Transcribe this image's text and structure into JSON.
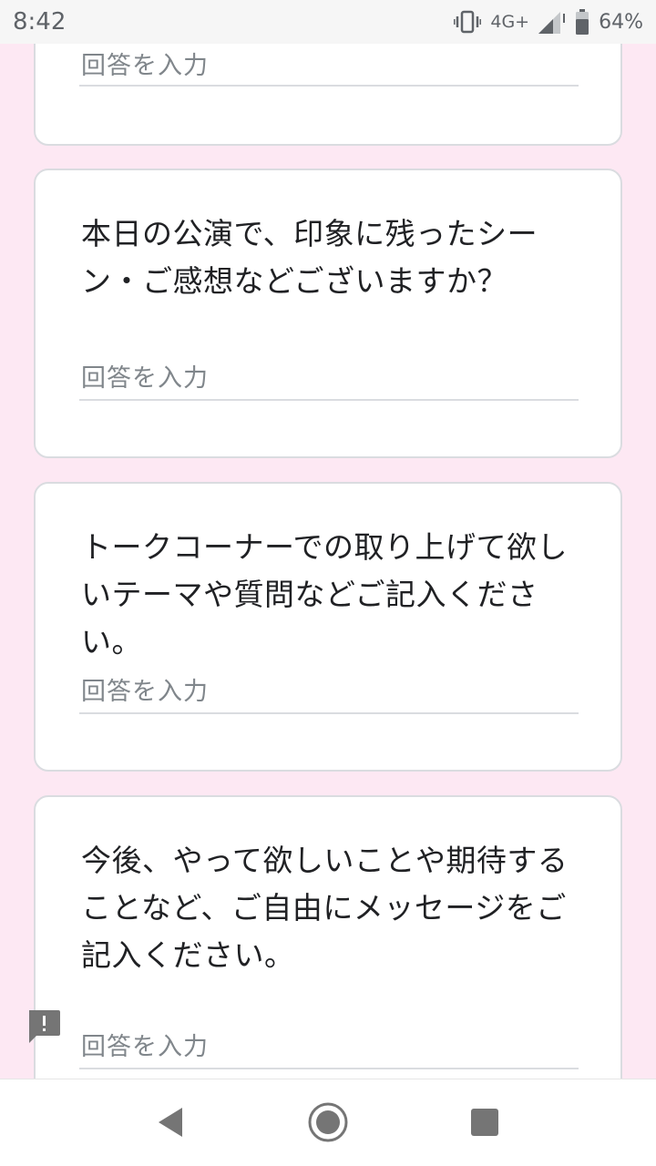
{
  "status_bar": {
    "time": "8:42",
    "network": "4G+",
    "battery": "64%"
  },
  "answer_placeholder": "回答を入力",
  "questions": [
    {
      "text": ""
    },
    {
      "text": "本日の公演で、印象に残ったシーン・ご感想などございますか？"
    },
    {
      "text": "トークコーナーでの取り上げて欲しいテーマや質問などご記入ください。"
    },
    {
      "text": "今後、やって欲しいことや期待することなど、ご自由にメッセージをご記入ください。"
    }
  ],
  "icons": {
    "vibrate": "vibrate-icon",
    "signal": "signal-icon",
    "battery": "battery-icon",
    "feedback": "feedback-icon",
    "back": "back-icon",
    "home": "home-icon",
    "recents": "recents-icon"
  },
  "colors": {
    "page_background": "#fde8f3",
    "card_background": "#ffffff",
    "card_border": "#dadce0",
    "placeholder_text": "#80868b"
  }
}
